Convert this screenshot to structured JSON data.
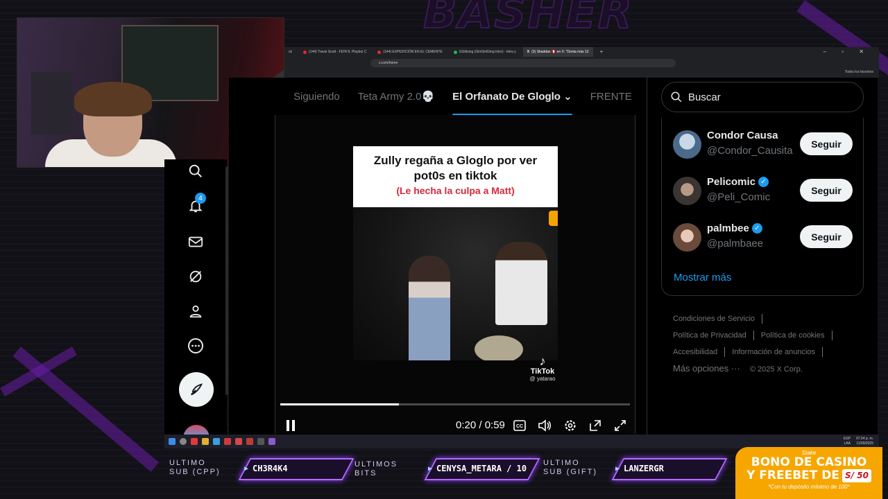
{
  "overlay": {
    "brand": "BASHER",
    "labels": {
      "last_sub": "ULTIMO\nSUB (CPP)",
      "last_bits": "ULTIMOS\nBITS",
      "last_gift": "ULTIMO\nSUB (GIFT)"
    },
    "values": {
      "last_sub": "CH3R4K4",
      "last_bits": "CENYSA_METARA / 10",
      "last_gift": "LANZERGR"
    },
    "casino": {
      "logo": "Stake",
      "line1": "BONO DE CASINO",
      "line2": "Y FREEBET DE",
      "amount": "S/ 50",
      "line3": "*Con tu depósito mínimo de 100*",
      "color": "#f7a600"
    },
    "accent": "#b36bff"
  },
  "browser": {
    "tabs": [
      {
        "label": "ck",
        "icon": "none"
      },
      {
        "label": "(144) Travis Scott - FE!N ft. Playboi C",
        "icon": "youtube-icon"
      },
      {
        "label": "(144) EXPEDICIÓN EN EL CEMENTE",
        "icon": "youtube-icon"
      },
      {
        "label": "GGlitzing (GloGlolGing Intro) - letra y",
        "icon": "spotify-icon"
      },
      {
        "label": "(3) Shaddan 🇵🇪 en X: \"Donta más 12",
        "icon": "x-icon"
      }
    ],
    "address": "x.com/home",
    "favorites": "Todos los favoritos"
  },
  "x": {
    "feed_tabs": [
      "Siguiendo",
      "Teta Army 2.0💀",
      "El Orfanato De Gloglo",
      "FRENTE"
    ],
    "active_tab": 2,
    "notification_count": "4",
    "search_placeholder": "Buscar",
    "who_to_follow": [
      {
        "name": "Condor Causa",
        "handle": "@Condor_Causita",
        "verified": false,
        "follow": "Seguir"
      },
      {
        "name": "Pelicomic",
        "handle": "@Peli_Comic",
        "verified": true,
        "follow": "Seguir"
      },
      {
        "name": "palmbee",
        "handle": "@palmbaee",
        "verified": true,
        "follow": "Seguir"
      }
    ],
    "show_more": "Mostrar más",
    "footer": {
      "terms": "Condiciones de Servicio",
      "privacy": "Política de Privacidad",
      "cookies": "Política de cookies",
      "accessibility": "Accesibilidad",
      "ads": "Información de anuncios",
      "more": "Más opciones ···",
      "copyright": "© 2025 X Corp."
    }
  },
  "video": {
    "caption_line1": "Zully regaña a Gloglo por ver",
    "caption_line2": "pot0s en tiktok",
    "caption_line3": "(Le hecha la culpa a Matt)",
    "tiktok_name": "TikTok",
    "tiktok_handle": "@ yatarao",
    "time": "0:20 / 0:59",
    "progress": 0.34
  },
  "taskbar": {
    "lang": "ESP\nLAA",
    "clock": "07:24 p. m.\n11/09/2025"
  }
}
